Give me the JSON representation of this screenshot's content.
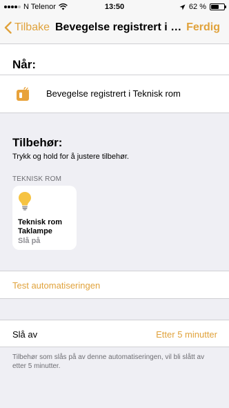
{
  "status_bar": {
    "carrier": "N Telenor",
    "time": "13:50",
    "battery_text": "62 %",
    "battery_level": 0.62
  },
  "nav": {
    "back_label": "Tilbake",
    "title": "Bevegelse registrert i Te...",
    "done_label": "Ferdig",
    "accent_color": "#e0a23b"
  },
  "when": {
    "header": "Når:",
    "trigger_label": "Bevegelse registrert i Teknisk rom",
    "trigger_icon": "motion-sensor-icon"
  },
  "accessories": {
    "header": "Tilbehør:",
    "hint": "Trykk og hold for å justere tilbehør.",
    "room_header": "TEKNISK ROM",
    "tile": {
      "icon": "lightbulb-icon",
      "name_line1": "Teknisk rom",
      "name_line2": "Taklampe",
      "state": "Slå på"
    }
  },
  "test": {
    "label": "Test automatiseringen"
  },
  "turn_off": {
    "label": "Slå av",
    "value": "Etter 5 minutter",
    "note": "Tilbehør som slås på av denne automatiseringen, vil bli slått av etter 5 minutter."
  }
}
